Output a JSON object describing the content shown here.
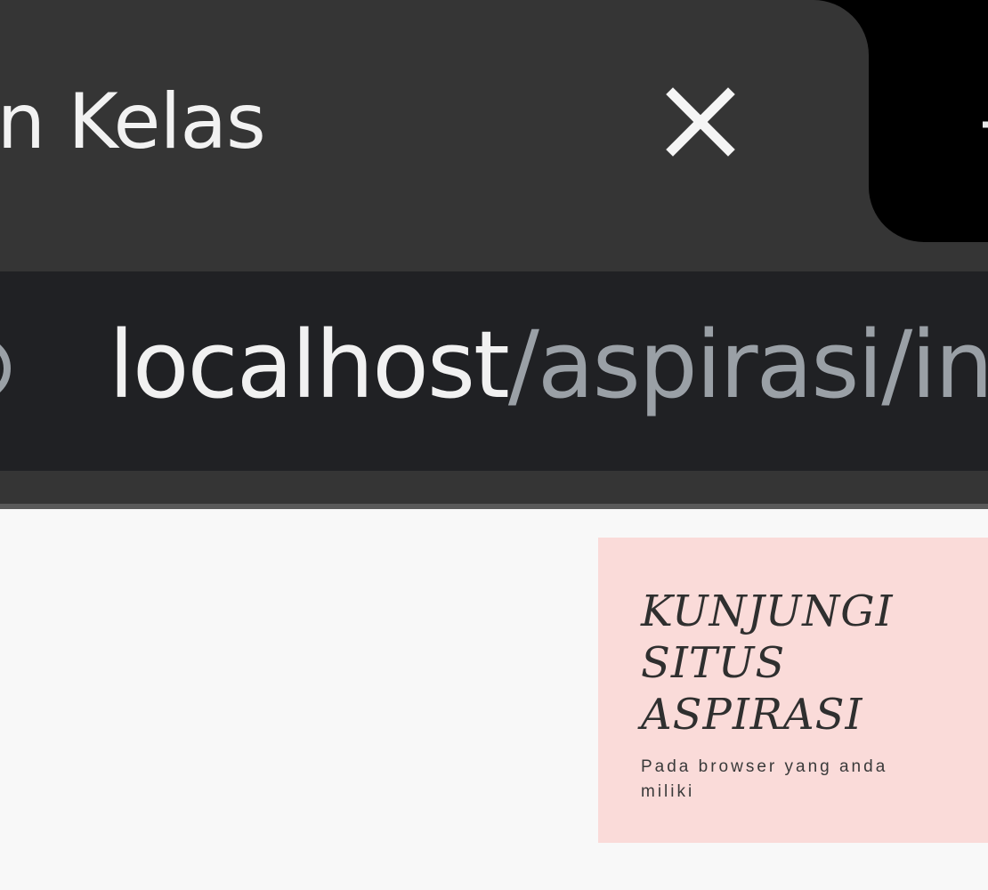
{
  "browser": {
    "tab": {
      "title": "lan Kelas",
      "close_icon": "close-icon"
    },
    "newtab_icon": "plus-icon",
    "address_bar": {
      "site_info_icon": "info-icon",
      "host": "localhost",
      "path": "/aspirasi/in"
    },
    "colors": {
      "tab_active": "#353535",
      "tabstrip": "#000000",
      "omnibox": "#202124",
      "url_host": "#f1f1f1",
      "url_path": "#9aa0a6"
    }
  },
  "page": {
    "promo": {
      "heading": "KUNJUNGI SITUS ASPIRASI",
      "subtext": "Pada browser yang anda miliki",
      "background": "#fadbd9"
    }
  }
}
